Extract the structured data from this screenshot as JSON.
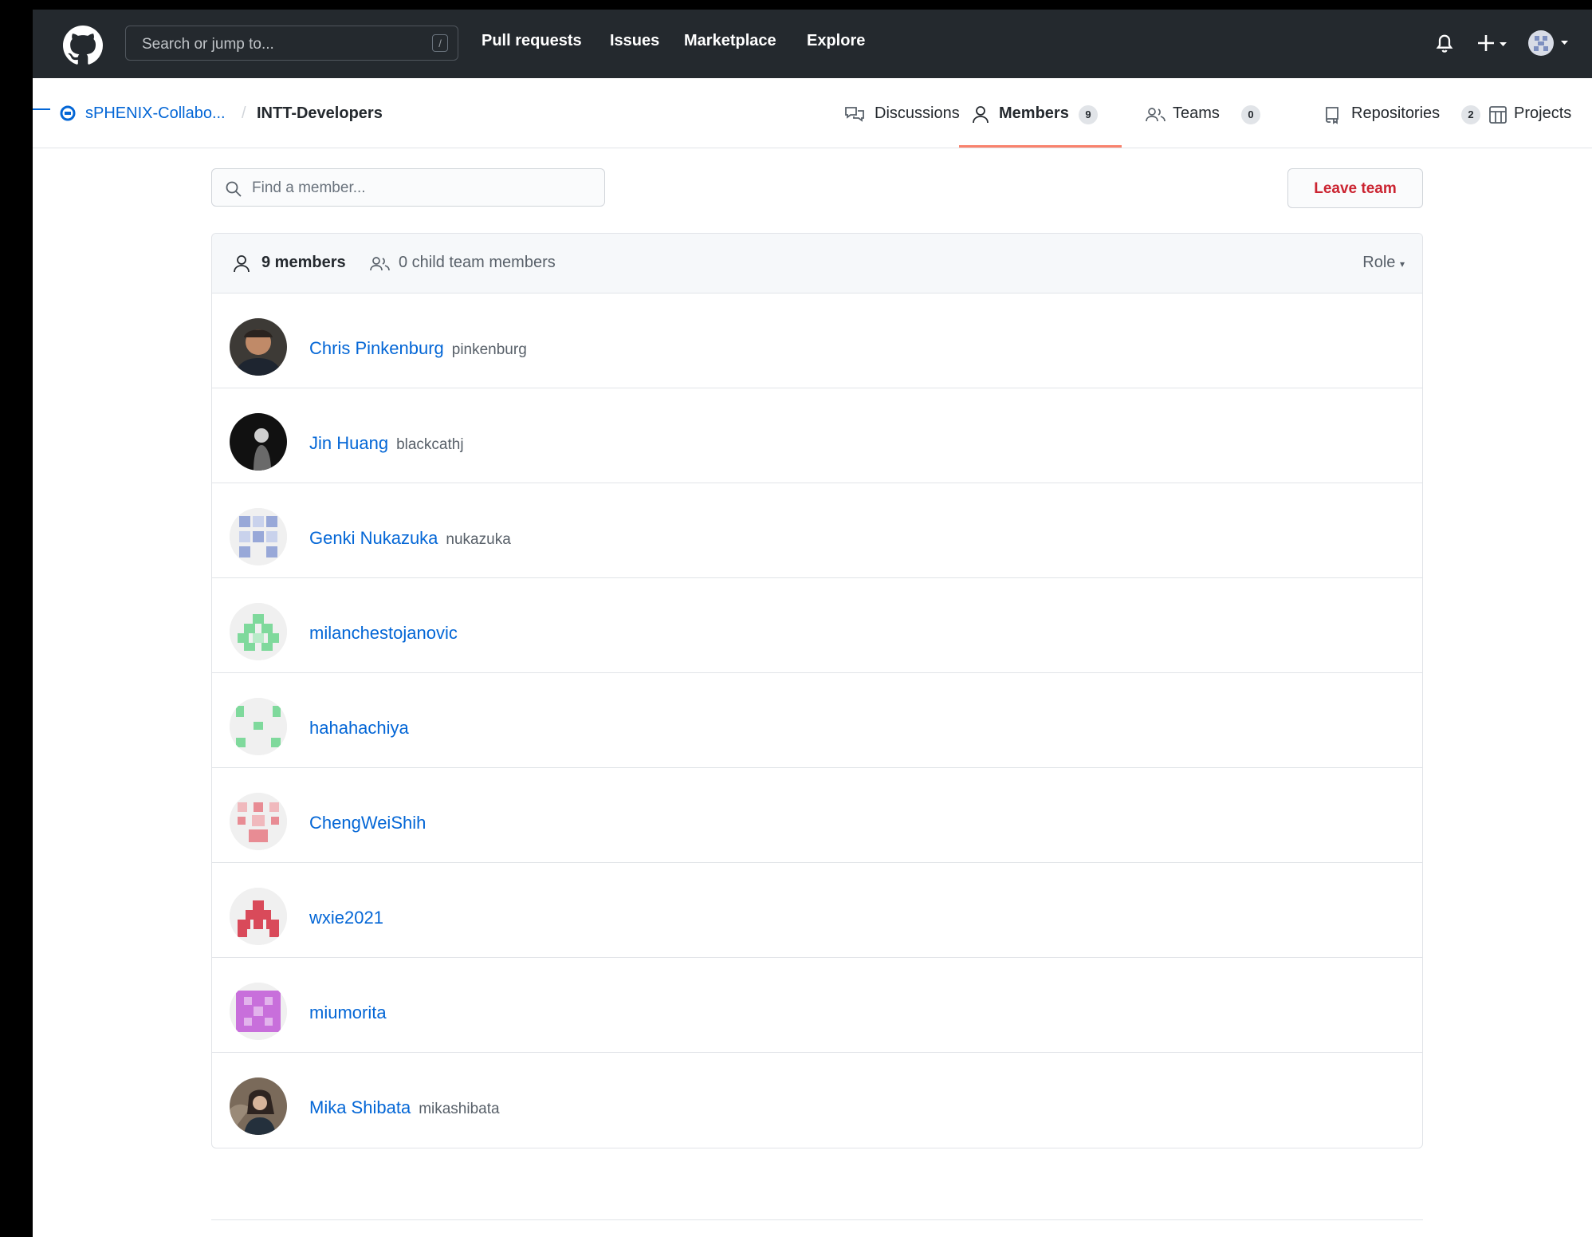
{
  "header": {
    "search_placeholder": "Search or jump to...",
    "slash_key": "/",
    "nav": [
      "Pull requests",
      "Issues",
      "Marketplace",
      "Explore"
    ],
    "icons": [
      "github-logo-icon",
      "bell-icon",
      "plus-icon",
      "user-avatar"
    ]
  },
  "team_header": {
    "org_name": "sPHENIX-Collabo...",
    "separator": "/",
    "team_name": "INTT-Developers",
    "tabs": [
      {
        "label": "Discussions",
        "count": null,
        "icon": "comment-discussion-icon"
      },
      {
        "label": "Members",
        "count": "9",
        "icon": "person-icon",
        "selected": true
      },
      {
        "label": "Teams",
        "count": "0",
        "icon": "people-icon"
      },
      {
        "label": "Repositories",
        "count": "2",
        "icon": "repo-icon"
      },
      {
        "label": "Projects",
        "count": null,
        "icon": "project-icon"
      }
    ]
  },
  "toolbar": {
    "find_placeholder": "Find a member...",
    "leave_label": "Leave team"
  },
  "members_box": {
    "members_count": "9 members",
    "child_members": "0 child team members",
    "role_label": "Role"
  },
  "members": [
    {
      "name": "Chris Pinkenburg",
      "login": "pinkenburg",
      "avatar": "photo"
    },
    {
      "name": "Jin Huang",
      "login": "blackcathj",
      "avatar": "photo"
    },
    {
      "name": "Genki Nukazuka",
      "login": "nukazuka",
      "avatar": "identicon"
    },
    {
      "name": "milanchestojanovic",
      "login": "",
      "avatar": "identicon"
    },
    {
      "name": "hahahachiya",
      "login": "",
      "avatar": "identicon"
    },
    {
      "name": "ChengWeiShih",
      "login": "",
      "avatar": "identicon"
    },
    {
      "name": "wxie2021",
      "login": "",
      "avatar": "identicon"
    },
    {
      "name": "miumorita",
      "login": "",
      "avatar": "identicon"
    },
    {
      "name": "Mika Shibata",
      "login": "mikashibata",
      "avatar": "photo"
    }
  ],
  "colors": {
    "header_bg": "#24292e",
    "link": "#0366d6",
    "danger": "#cb2431",
    "tab_underline": "#f9826c"
  }
}
